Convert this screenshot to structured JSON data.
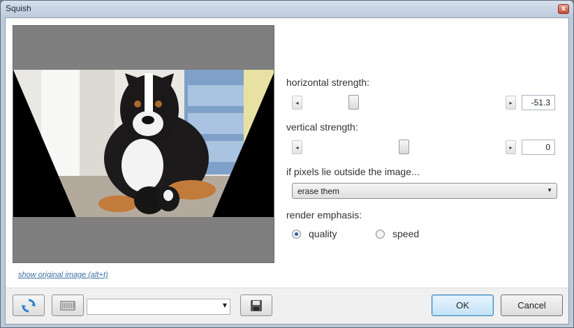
{
  "window": {
    "title": "Squish",
    "close_label": "x"
  },
  "preview": {
    "show_original_link": "show original image (alt+t)"
  },
  "horizontal": {
    "label": "horizontal strength:",
    "value": "-51.3",
    "position": 0.24,
    "left_arrow": "◂",
    "right_arrow": "▸"
  },
  "vertical": {
    "label": "vertical strength:",
    "value": "0",
    "position": 0.5,
    "left_arrow": "◂",
    "right_arrow": "▸"
  },
  "outside": {
    "label": "if pixels lie outside the image...",
    "selected": "erase them",
    "caret": "▼"
  },
  "emphasis": {
    "label": "render emphasis:",
    "options": [
      {
        "label": "quality",
        "checked": true
      },
      {
        "label": "speed",
        "checked": false
      }
    ]
  },
  "toolbar": {
    "reset_icon": "refresh-icon",
    "randomize_icon": "dice-icon",
    "preset_value": "",
    "preset_caret": "▼",
    "save_icon": "save-preset-icon"
  },
  "buttons": {
    "ok": "OK",
    "cancel": "Cancel"
  },
  "colors": {
    "link": "#3a6ea5",
    "title_bg": "#bccadb",
    "preview_bg": "#7f7f7f"
  }
}
